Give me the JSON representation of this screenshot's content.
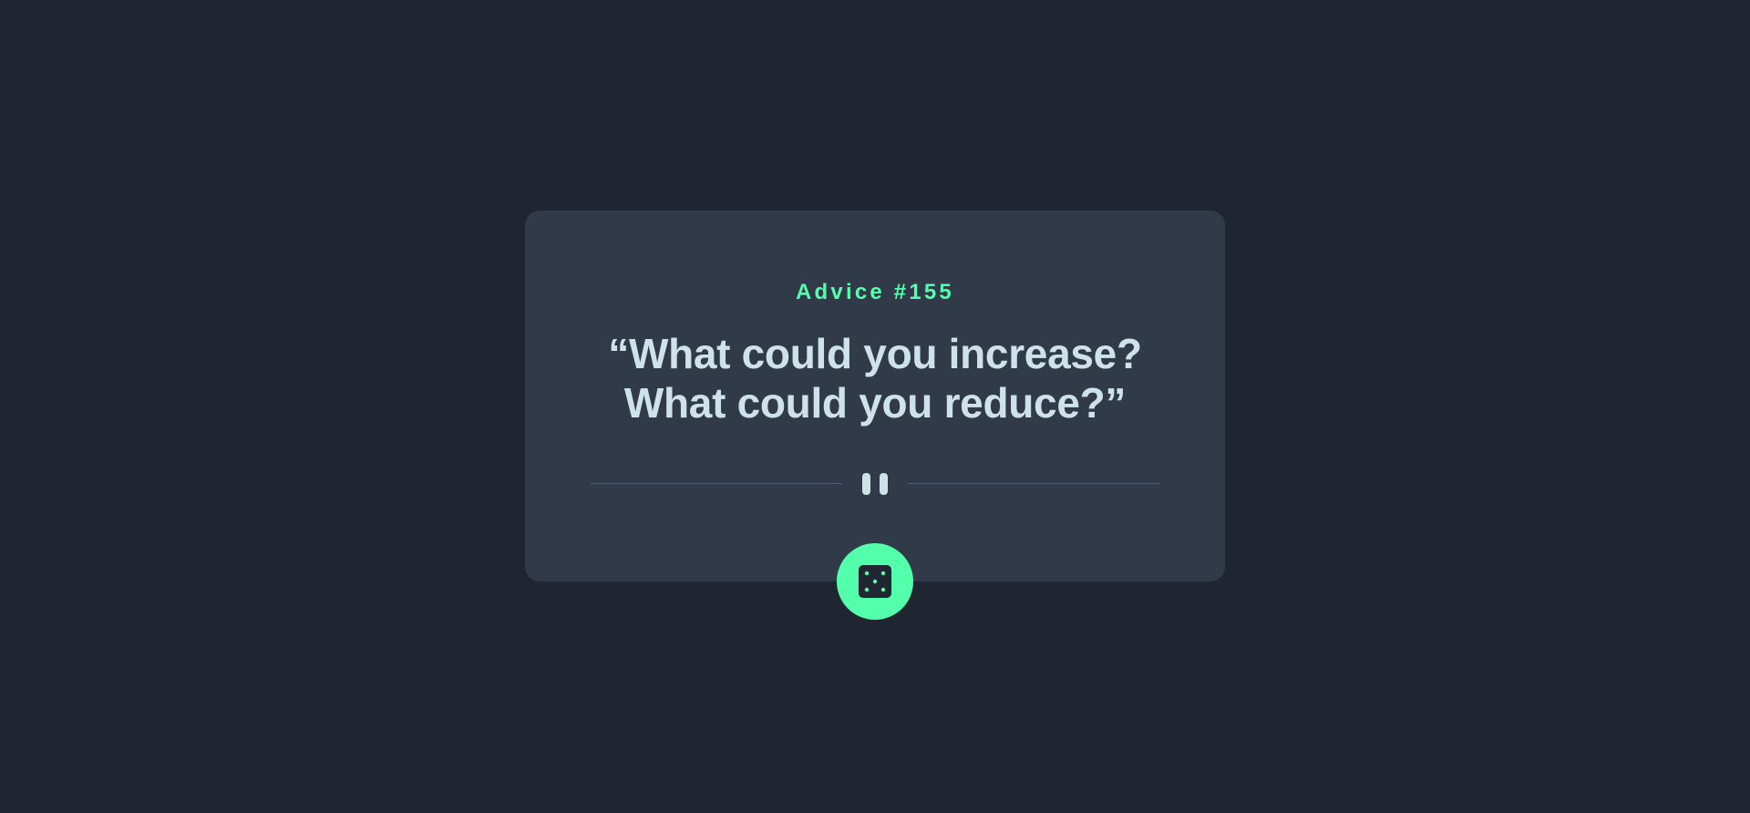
{
  "advice": {
    "label": "Advice #155",
    "quote_line1": "“What could you increase?",
    "quote_line2": "What could you reduce?”"
  },
  "icons": {
    "divider": "pause-icon",
    "button": "dice-icon"
  },
  "colors": {
    "background": "#1f2632",
    "card": "#313a48",
    "accent": "#53ffaa",
    "text": "#cee3e9",
    "divider": "#4f5d74"
  }
}
